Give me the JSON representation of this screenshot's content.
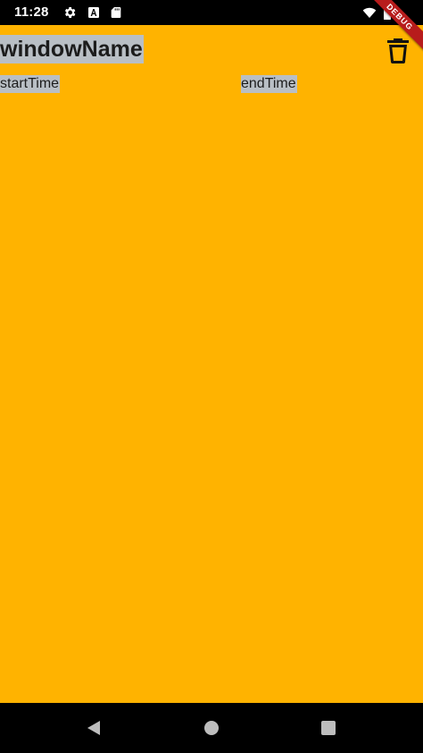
{
  "status_bar": {
    "time": "11:28",
    "left_icons": [
      "settings-icon",
      "font-a-icon",
      "sd-card-icon"
    ],
    "right_icons": [
      "wifi-icon",
      "battery-icon"
    ]
  },
  "debug_banner": "DEBUG",
  "window": {
    "name": "windowName",
    "start_time": "startTime",
    "end_time": "endTime"
  },
  "actions": {
    "delete_icon": "trash-icon"
  },
  "navigation": {
    "buttons": [
      "back-icon",
      "home-icon",
      "recents-icon"
    ]
  },
  "colors": {
    "background": "#FFB300",
    "label_highlight": "#B9BFC5",
    "system_bars": "#000000",
    "debug_ribbon": "#B71C1C"
  }
}
